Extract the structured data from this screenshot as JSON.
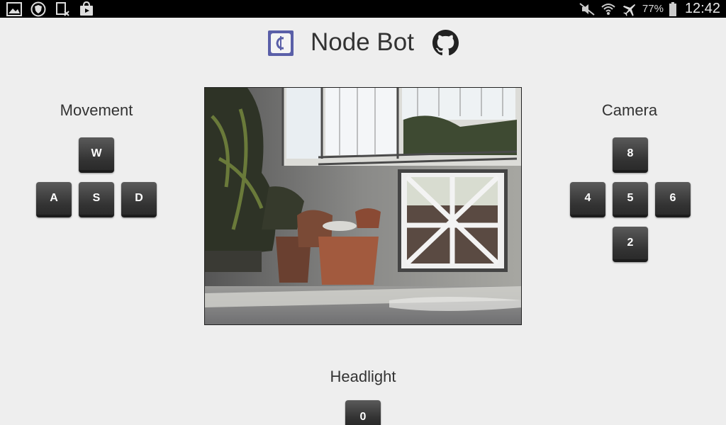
{
  "statusbar": {
    "left_icons": [
      "gallery-icon",
      "shield-icon",
      "sim-icon",
      "store-icon"
    ],
    "battery": "77%",
    "time": "12:42"
  },
  "header": {
    "title": "Node Bot"
  },
  "movement": {
    "title": "Movement",
    "keys": {
      "up": "W",
      "left": "A",
      "down": "S",
      "right": "D"
    }
  },
  "camera": {
    "title": "Camera",
    "keys": {
      "up": "8",
      "left": "4",
      "center": "5",
      "right": "6",
      "down": "2"
    }
  },
  "headlight": {
    "title": "Headlight",
    "key": "0"
  },
  "colors": {
    "background": "#eeeeee",
    "key": "#333333",
    "logo": "#5a5fa8"
  }
}
